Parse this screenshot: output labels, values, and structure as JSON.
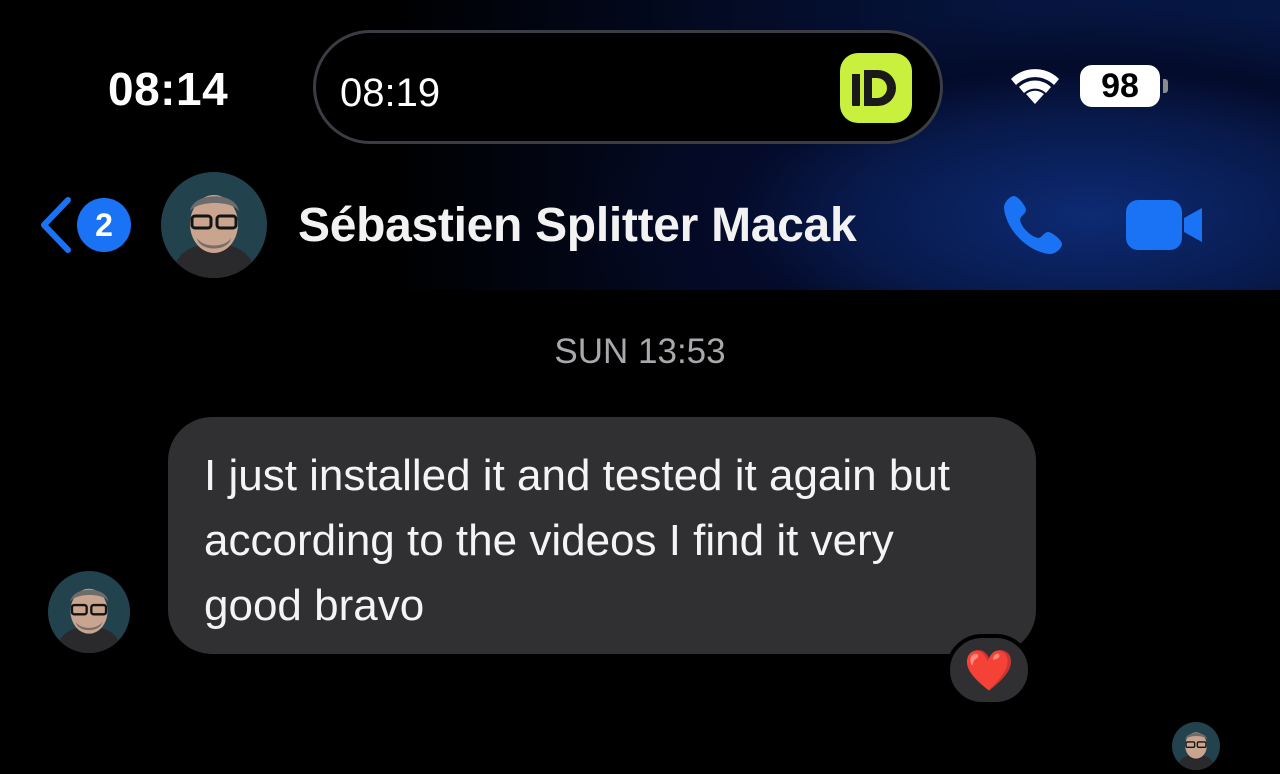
{
  "status_bar": {
    "time": "08:14",
    "island_time": "08:19",
    "island_app_icon": "id-app-icon",
    "wifi_icon": "wifi-icon",
    "battery_level": "98",
    "battery_icon": "battery-icon"
  },
  "nav": {
    "back_icon": "chevron-left-icon",
    "unread_count": "2",
    "contact_name": "Sébastien Splitter Macak",
    "call_icon": "phone-icon",
    "video_icon": "video-camera-icon"
  },
  "conversation": {
    "timestamp": "SUN 13:53",
    "messages": [
      {
        "text": "I just installed it and tested it again but according to the videos I find it very good bravo",
        "reaction": "❤️"
      }
    ]
  },
  "colors": {
    "accent": "#1a73f5",
    "bubble": "#303033",
    "island_app": "#c8f03c",
    "background": "#000000"
  }
}
